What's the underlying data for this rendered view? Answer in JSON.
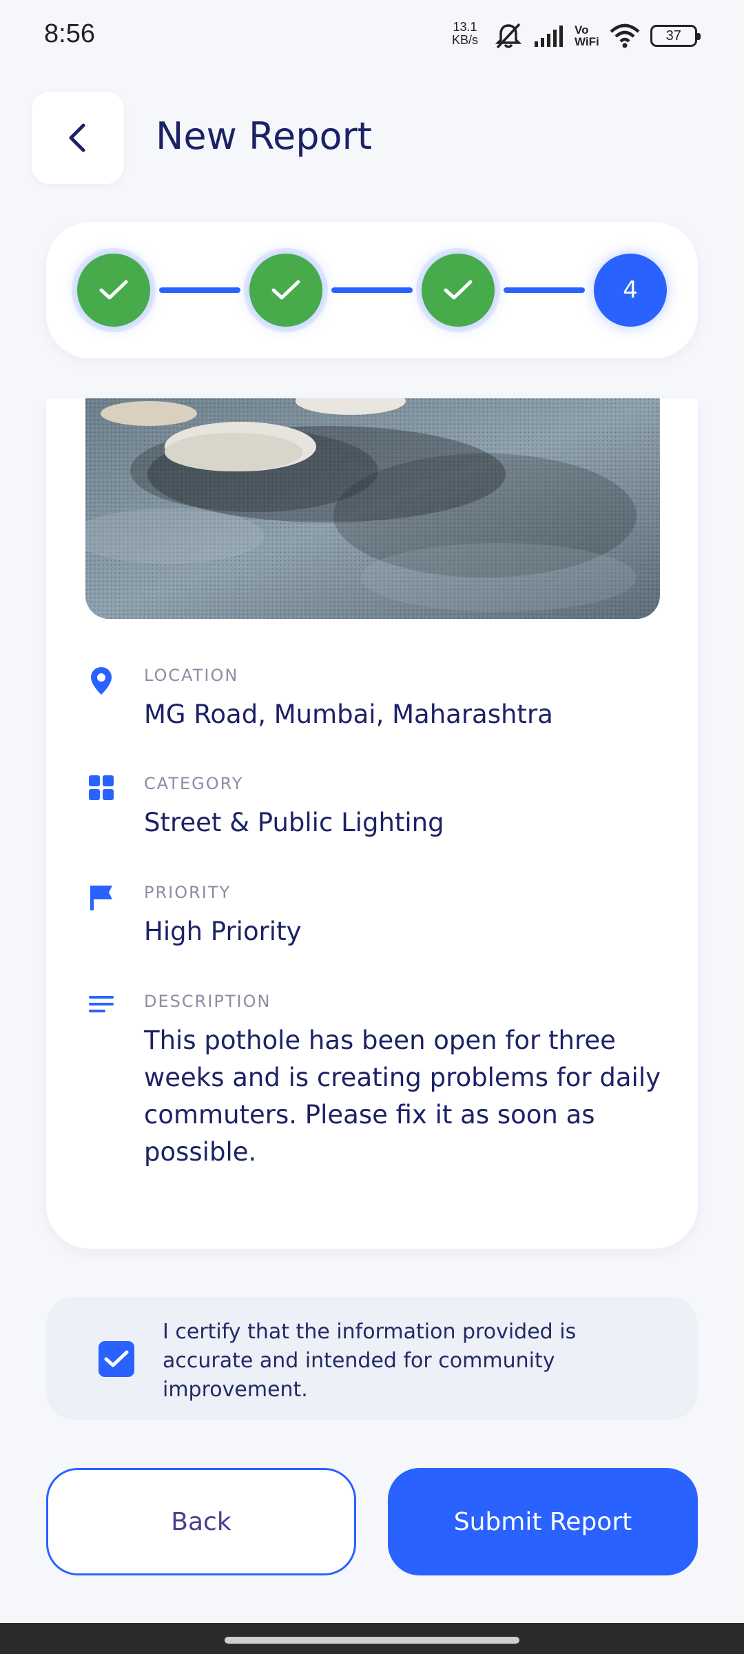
{
  "status_bar": {
    "time": "8:56",
    "net_speed_value": "13.1",
    "net_speed_unit": "KB/s",
    "vowifi_top": "Vo",
    "vowifi_bottom": "WiFi",
    "battery": "37"
  },
  "header": {
    "title": "New Report",
    "back_icon": "chevron-left-icon"
  },
  "stepper": {
    "current_step_label": "4",
    "steps_completed": 3,
    "total_steps": 4
  },
  "summary": {
    "location": {
      "label": "LOCATION",
      "value": "MG Road, Mumbai, Maharashtra",
      "icon": "map-pin-icon"
    },
    "category": {
      "label": "CATEGORY",
      "value": "Street & Public Lighting",
      "icon": "grid-icon"
    },
    "priority": {
      "label": "PRIORITY",
      "value": "High Priority",
      "icon": "flag-icon"
    },
    "description": {
      "label": "DESCRIPTION",
      "value": "This pothole has been open for three weeks and is creating problems for daily commuters. Please fix it as soon as possible.",
      "icon": "text-lines-icon"
    }
  },
  "certification": {
    "checked": true,
    "text": "I certify that the information provided is accurate and intended for community improvement."
  },
  "actions": {
    "back_label": "Back",
    "submit_label": "Submit Report"
  },
  "colors": {
    "primary": "#2962FF",
    "success": "#47AA4B",
    "text_dark": "#1C2266",
    "label_gray": "#8A8EA3",
    "background": "#F5F7FB"
  }
}
